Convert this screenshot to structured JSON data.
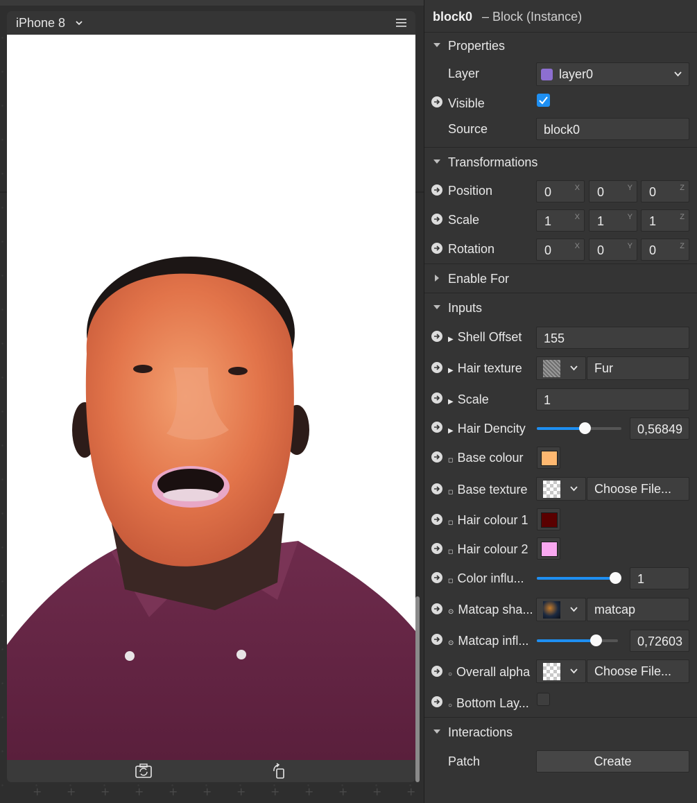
{
  "device": {
    "name": "iPhone 8"
  },
  "inspector": {
    "object_name": "block0",
    "object_type": "– Block (Instance)",
    "sections": {
      "properties": "Properties",
      "transformations": "Transformations",
      "enable_for": "Enable For",
      "inputs": "Inputs",
      "interactions": "Interactions"
    },
    "properties": {
      "layer_label": "Layer",
      "layer_value": "layer0",
      "layer_color": "#8d6fd1",
      "visible_label": "Visible",
      "visible_checked": true,
      "source_label": "Source",
      "source_value": "block0"
    },
    "transformations": {
      "position_label": "Position",
      "position": [
        "0",
        "0",
        "0"
      ],
      "scale_label": "Scale",
      "scale": [
        "1",
        "1",
        "1"
      ],
      "rotation_label": "Rotation",
      "rotation": [
        "0",
        "0",
        "0"
      ],
      "axes": [
        "X",
        "Y",
        "Z"
      ]
    },
    "inputs": {
      "shell_offset_label": "Shell Offset",
      "shell_offset_value": "155",
      "hair_texture_label": "Hair texture",
      "hair_texture_value": "Fur",
      "scale_label": "Scale",
      "scale_value": "1",
      "hair_dencity_label": "Hair Dencity",
      "hair_dencity_value": "0,56849",
      "hair_dencity_fraction": 0.56849,
      "base_colour_label": "Base colour",
      "base_colour": "#ffb870",
      "base_texture_label": "Base texture",
      "base_texture_value": "Choose File...",
      "hair_colour1_label": "Hair colour 1",
      "hair_colour1": "#5a0000",
      "hair_colour2_label": "Hair colour 2",
      "hair_colour2": "#f9a8f0",
      "color_influ_label": "Color influ...",
      "color_influ_value": "1",
      "color_influ_fraction": 1.0,
      "matcap_sha_label": "Matcap sha...",
      "matcap_sha_value": "matcap",
      "matcap_infl_label": "Matcap infl...",
      "matcap_infl_value": "0,72603",
      "matcap_infl_fraction": 0.72603,
      "overall_alpha_label": "Overall alpha",
      "overall_alpha_value": "Choose File...",
      "bottom_lay_label": "Bottom Lay...",
      "bottom_lay_checked": false
    },
    "interactions": {
      "patch_label": "Patch",
      "create_label": "Create"
    }
  },
  "colors": {
    "accent": "#1e8ff2"
  }
}
